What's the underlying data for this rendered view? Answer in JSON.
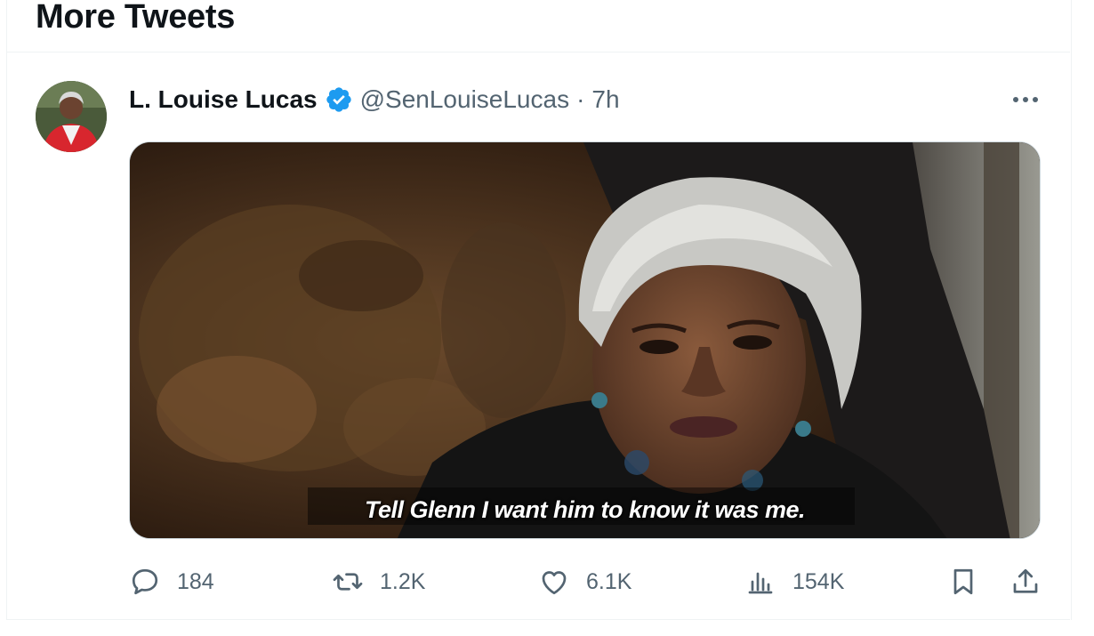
{
  "section": {
    "title": "More Tweets"
  },
  "tweet": {
    "author_name": "L. Louise Lucas",
    "handle": "@SenLouiseLucas",
    "separator": "·",
    "time": "7h",
    "media_caption": "Tell Glenn I want him to know it was me.",
    "actions": {
      "replies": "184",
      "retweets": "1.2K",
      "likes": "6.1K",
      "views": "154K"
    }
  },
  "icons": {
    "verified": "verified-badge-icon",
    "more": "more-options-icon",
    "reply": "reply-icon",
    "retweet": "retweet-icon",
    "like": "heart-icon",
    "views": "views-chart-icon",
    "bookmark": "bookmark-icon",
    "share": "share-icon"
  },
  "colors": {
    "text_primary": "#0f1419",
    "text_secondary": "#536471",
    "verified_blue": "#1d9bf0",
    "border": "#eff3f4"
  }
}
